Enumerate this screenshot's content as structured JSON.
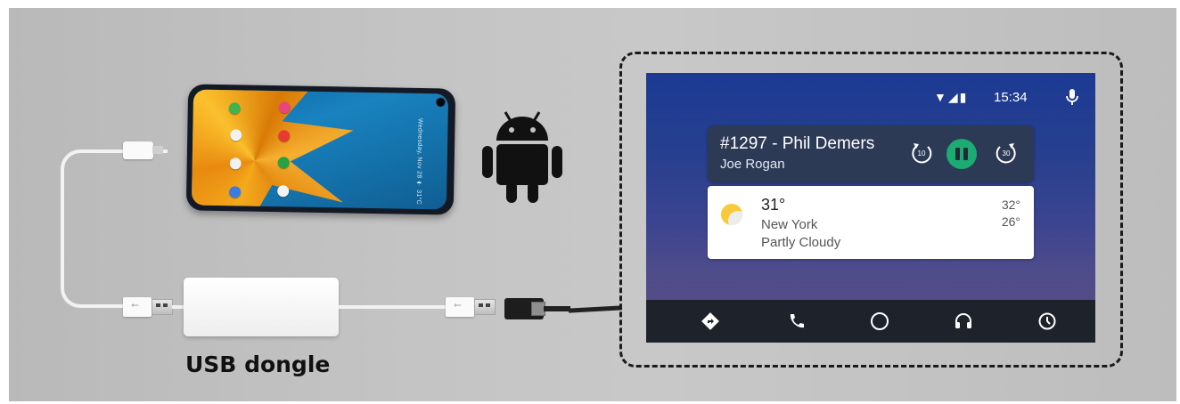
{
  "caption": {
    "dongle_label": "USB dongle"
  },
  "phone": {
    "side_text": "Wednesday, Nov 28  ☂ 31°C"
  },
  "head_unit": {
    "status": {
      "icons": "▼◢▮",
      "time": "15:34"
    },
    "media": {
      "title": "#1297 - Phil Demers",
      "artist": "Joe Rogan",
      "rewind_seconds": "10",
      "forward_seconds": "30",
      "state": "playing"
    },
    "weather": {
      "temperature": "31°",
      "city": "New York",
      "condition": "Partly Cloudy",
      "high": "32°",
      "low": "26°"
    },
    "nav": [
      "navigation-icon",
      "phone-icon",
      "home-icon",
      "headphones-icon",
      "recents-icon"
    ]
  },
  "colors": {
    "play_button": "#1cab73",
    "screen_top": "#1c3a94",
    "screen_bottom": "#5b4d84",
    "nav_bar": "#1e232b"
  }
}
